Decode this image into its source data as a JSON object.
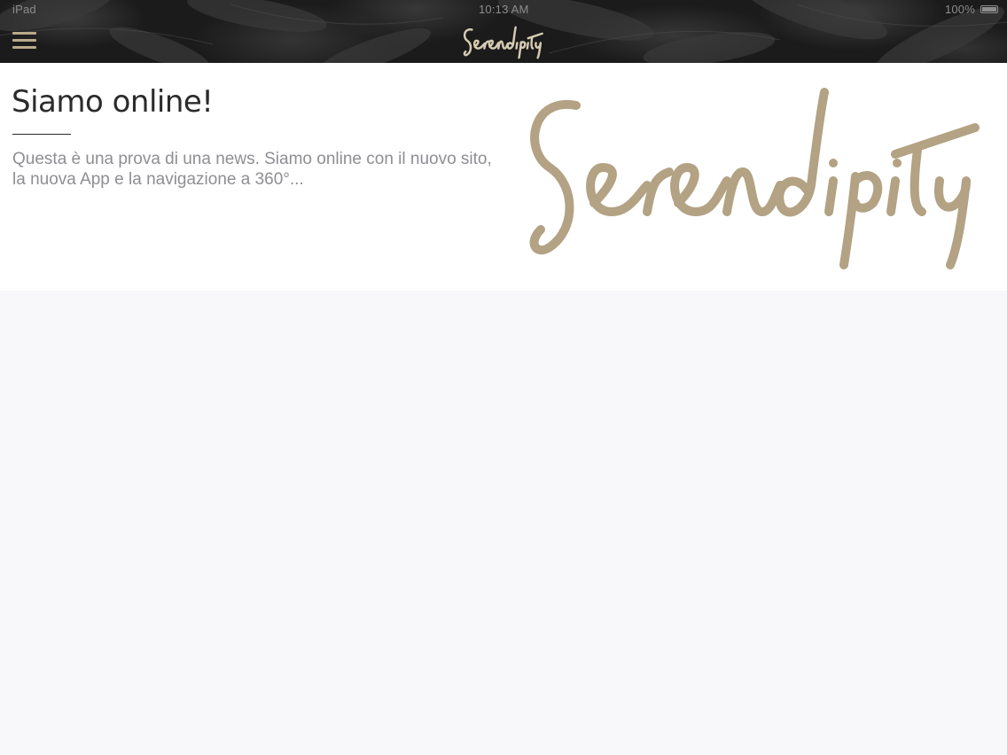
{
  "status_bar": {
    "carrier": "iPad",
    "time": "10:13 AM",
    "battery": "100%"
  },
  "header": {
    "menu_icon": "hamburger-menu-icon",
    "logo_text": "Serendipity"
  },
  "news": [
    {
      "title": "Siamo online!",
      "excerpt": "Questa è una prova di una news. Siamo online con il nuovo sito, la nuova App e la navigazione a 360°...",
      "image_logo_text": "Serendipity"
    }
  ],
  "colors": {
    "accent_gold": "#b3a283",
    "header_dark": "#1b1b1b",
    "page_bg": "#f8f7fa",
    "excerpt_gray": "#8e8e93"
  }
}
